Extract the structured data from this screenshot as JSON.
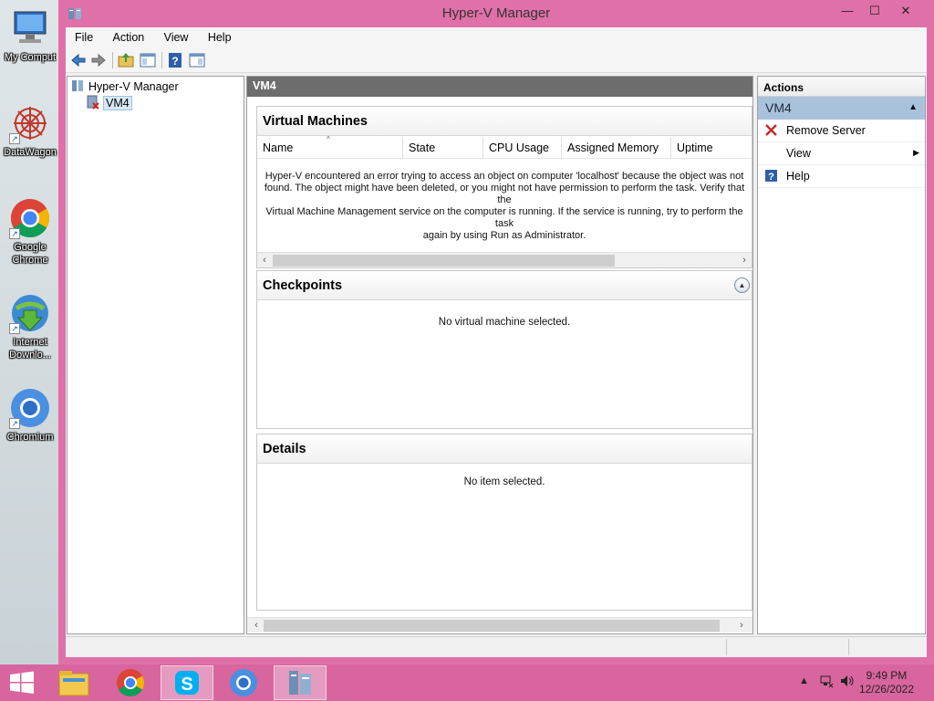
{
  "desktop": {
    "icons": [
      {
        "label": "My Comput",
        "icon": "computer-icon"
      },
      {
        "label": "DataWagon",
        "icon": "datawagon-icon"
      },
      {
        "label": "Google Chrome",
        "icon": "chrome-icon"
      },
      {
        "label": "Internet Downlo...",
        "icon": "idm-icon"
      },
      {
        "label": "Chromium",
        "icon": "chromium-icon"
      }
    ]
  },
  "window": {
    "title": "Hyper-V Manager",
    "controls": {
      "minimize": "—",
      "maximize": "☐",
      "close": "✕"
    }
  },
  "menubar": {
    "file": "File",
    "action": "Action",
    "view": "View",
    "help": "Help"
  },
  "toolbar": {
    "buttons": [
      "back-icon",
      "forward-icon",
      "up-folder-icon",
      "show-hide-tree-icon",
      "help-icon",
      "show-hide-action-pane-icon"
    ]
  },
  "tree": {
    "root": "Hyper-V Manager",
    "child": "VM4"
  },
  "center": {
    "header": "VM4",
    "virtual_machines": {
      "title": "Virtual Machines",
      "columns": [
        "Name",
        "State",
        "CPU Usage",
        "Assigned Memory",
        "Uptime"
      ],
      "message_lines": [
        "Hyper-V encountered an error trying to access an object on computer 'localhost' because the object was not",
        "found. The object might have been deleted, or you might not have permission to perform the task. Verify that the",
        "Virtual Machine Management service on the computer is running. If the service is running, try to perform the task",
        "again by using Run as Administrator."
      ]
    },
    "checkpoints": {
      "title": "Checkpoints",
      "message": "No virtual machine selected."
    },
    "details": {
      "title": "Details",
      "message": "No item selected."
    }
  },
  "actions": {
    "header": "Actions",
    "group": "VM4",
    "items": [
      {
        "label": "Remove Server",
        "icon": "remove-icon"
      },
      {
        "label": "View",
        "icon": "",
        "submenu": true
      },
      {
        "label": "Help",
        "icon": "help-icon"
      }
    ]
  },
  "taskbar": {
    "items": [
      "start-icon",
      "file-explorer-icon",
      "chrome-icon",
      "skype-icon",
      "chromium-icon",
      "hyperv-manager-icon"
    ],
    "clock": {
      "time": "9:49 PM",
      "date": "12/26/2022"
    }
  },
  "colors": {
    "window_frame": "#e070a8",
    "taskbar": "#d8659e",
    "actions_group": "#a9c2dc",
    "center_header": "#6d6d6d"
  }
}
